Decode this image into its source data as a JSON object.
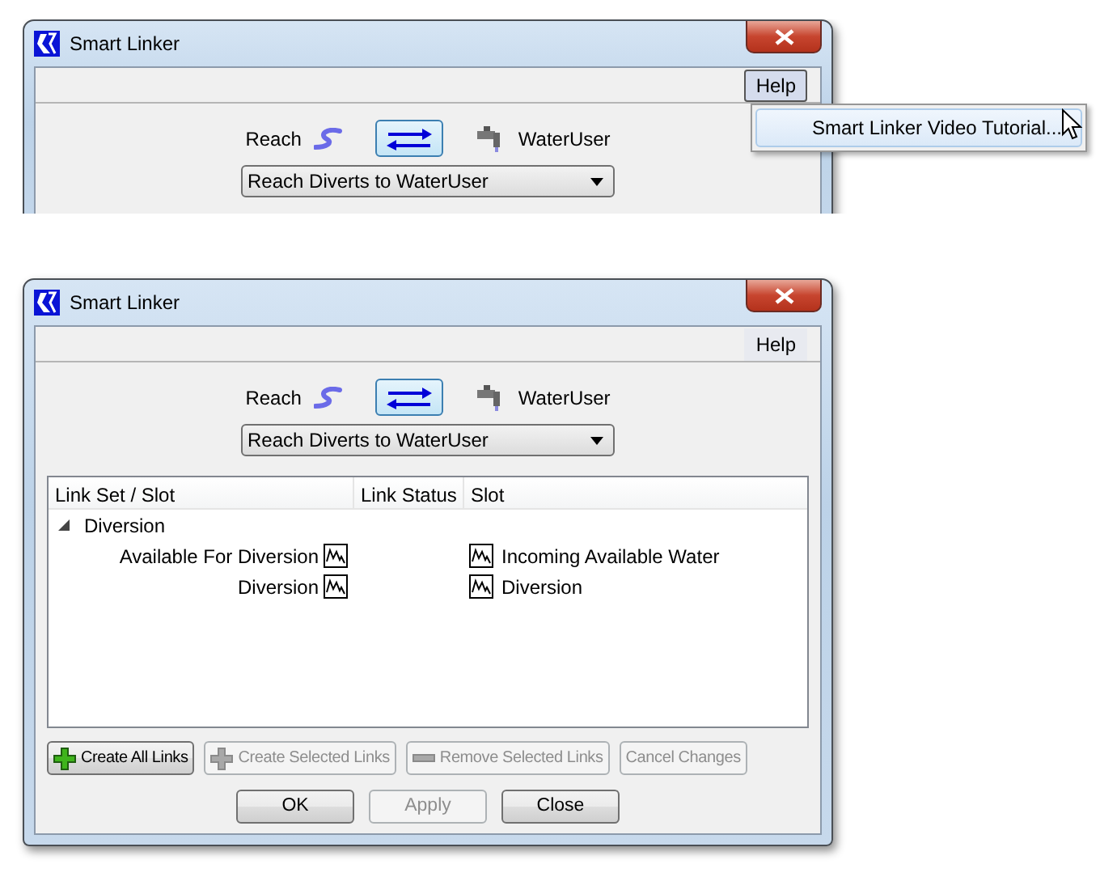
{
  "windows": [
    {
      "title": "Smart Linker",
      "menu": [
        {
          "label": "Help",
          "selected": true
        }
      ],
      "popup_menu": {
        "items": [
          {
            "label": "Smart Linker Video Tutorial...",
            "selected": true
          }
        ]
      },
      "source": "Reach",
      "target": "WaterUser",
      "link_type": "Reach Diverts to WaterUser"
    },
    {
      "title": "Smart Linker",
      "menu": [
        {
          "label": "Help",
          "selected": false
        }
      ],
      "source": "Reach",
      "target": "WaterUser",
      "link_type": "Reach Diverts to WaterUser",
      "table": {
        "columns": [
          "Link Set / Slot",
          "Link Status",
          "Slot"
        ],
        "groups": [
          {
            "label": "Diversion",
            "expanded": true,
            "children": [
              {
                "slot": "Available For Diversion",
                "linked_slot": "Incoming Available Water"
              },
              {
                "slot": "Diversion",
                "linked_slot": "Diversion"
              }
            ]
          }
        ]
      },
      "action_buttons": [
        {
          "label": "Create All Links",
          "kind": "add",
          "disabled": false
        },
        {
          "label": "Create Selected Links",
          "kind": "add",
          "disabled": true
        },
        {
          "label": "Remove Selected Links",
          "kind": "remove",
          "disabled": true
        },
        {
          "label": "Cancel Changes",
          "kind": "plain",
          "disabled": true
        }
      ],
      "dialog_buttons": [
        {
          "label": "OK",
          "disabled": false
        },
        {
          "label": "Apply",
          "disabled": true
        },
        {
          "label": "Close",
          "disabled": false
        }
      ]
    }
  ]
}
